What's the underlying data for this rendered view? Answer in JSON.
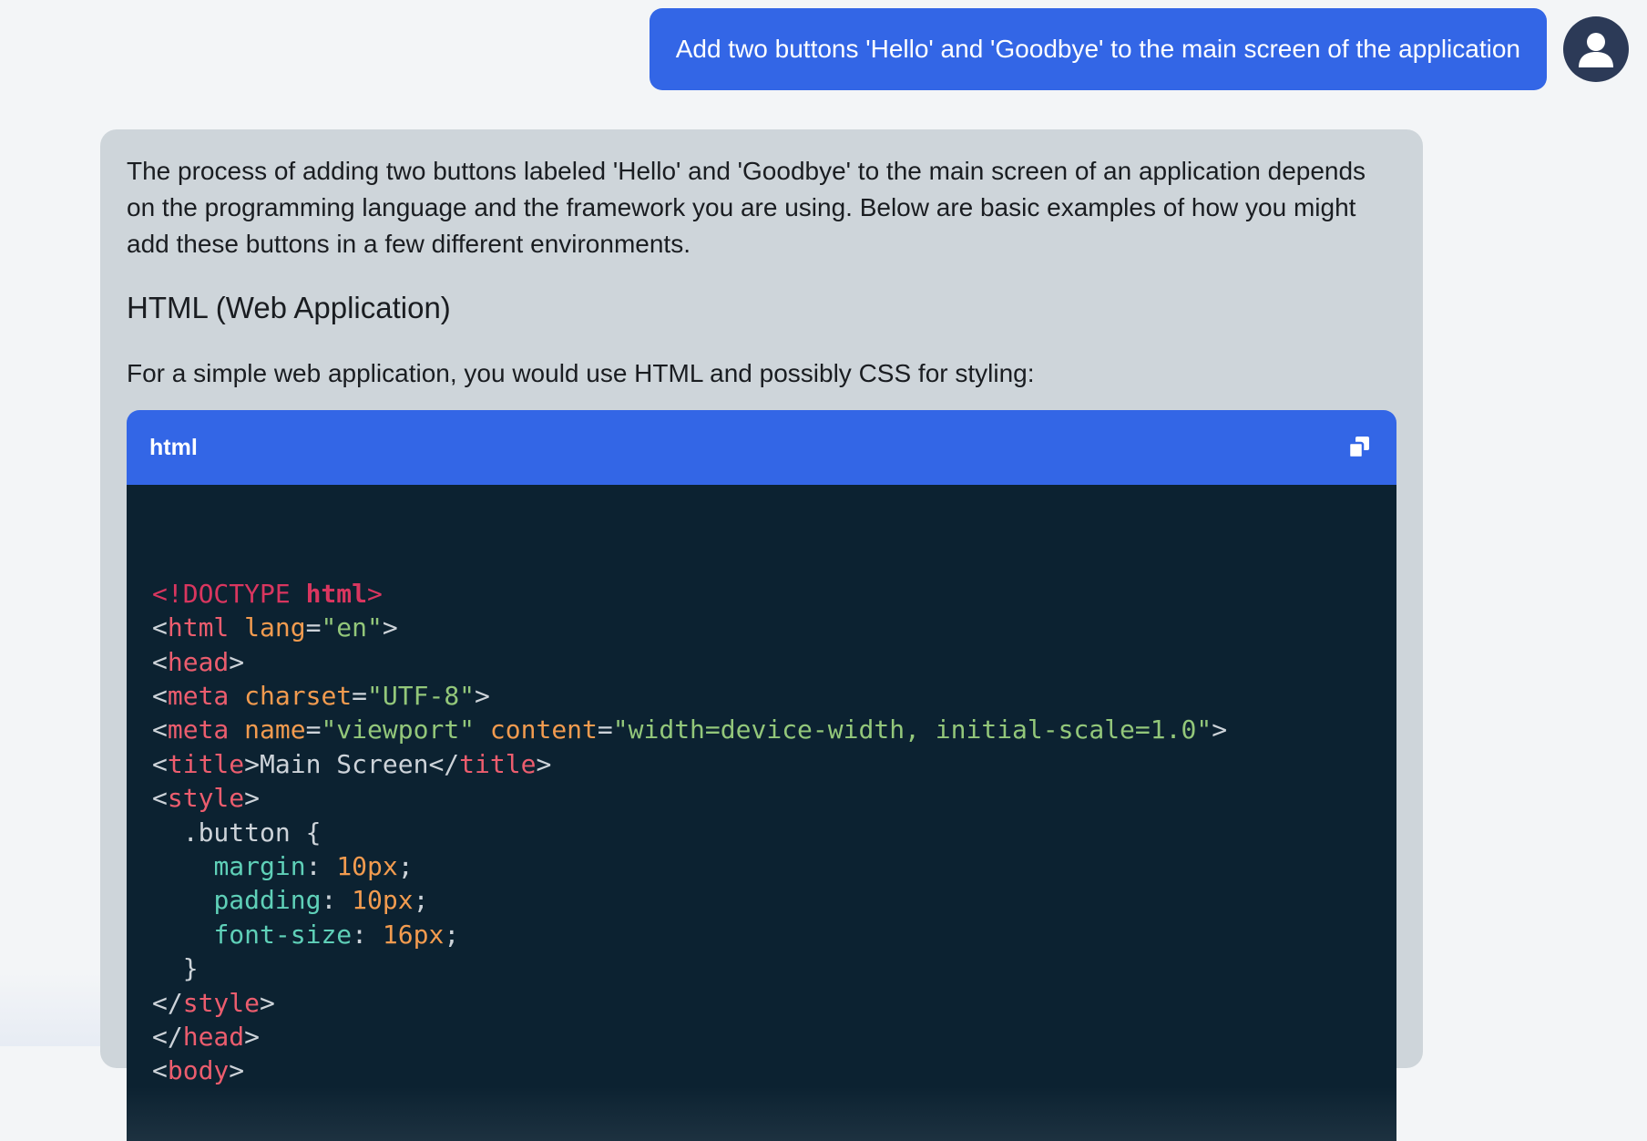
{
  "user_message": {
    "text": "Add two buttons 'Hello' and 'Goodbye' to the main screen of the application"
  },
  "assistant_message": {
    "intro": "The process of adding two buttons labeled 'Hello' and 'Goodbye' to the main screen of an application depends on the programming language and the framework you are using. Below are basic examples of how you might add these buttons in a few different environments.",
    "section_heading": "HTML (Web Application)",
    "subintro": "For a simple web application, you would use HTML and possibly CSS for styling:",
    "code_block": {
      "language": "html",
      "copy_icon": "copy-icon",
      "lines": [
        [
          [
            "<!DOCTYPE ",
            "#d9365f"
          ],
          [
            "html",
            "#d9365f",
            "bold"
          ],
          [
            ">",
            "#d9365f"
          ]
        ],
        [
          [
            "<",
            "#cdd3d9"
          ],
          [
            "html",
            "#ec5d6e"
          ],
          [
            " ",
            "#cdd3d9"
          ],
          [
            "lang",
            "#f29b4f"
          ],
          [
            "=",
            "#cdd3d9"
          ],
          [
            "\"en\"",
            "#93c77a"
          ],
          [
            ">",
            "#cdd3d9"
          ]
        ],
        [
          [
            "<",
            "#cdd3d9"
          ],
          [
            "head",
            "#ec5d6e"
          ],
          [
            ">",
            "#cdd3d9"
          ]
        ],
        [
          [
            "<",
            "#cdd3d9"
          ],
          [
            "meta",
            "#ec5d6e"
          ],
          [
            " ",
            "#cdd3d9"
          ],
          [
            "charset",
            "#f29b4f"
          ],
          [
            "=",
            "#cdd3d9"
          ],
          [
            "\"UTF-8\"",
            "#93c77a"
          ],
          [
            ">",
            "#cdd3d9"
          ]
        ],
        [
          [
            "<",
            "#cdd3d9"
          ],
          [
            "meta",
            "#ec5d6e"
          ],
          [
            " ",
            "#cdd3d9"
          ],
          [
            "name",
            "#f29b4f"
          ],
          [
            "=",
            "#cdd3d9"
          ],
          [
            "\"viewport\"",
            "#93c77a"
          ],
          [
            " ",
            "#cdd3d9"
          ],
          [
            "content",
            "#f29b4f"
          ],
          [
            "=",
            "#cdd3d9"
          ],
          [
            "\"width=device-width, initial-scale=1.0\"",
            "#93c77a"
          ],
          [
            ">",
            "#cdd3d9"
          ]
        ],
        [
          [
            "<",
            "#cdd3d9"
          ],
          [
            "title",
            "#ec5d6e"
          ],
          [
            ">Main Screen</",
            "#cdd3d9"
          ],
          [
            "title",
            "#ec5d6e"
          ],
          [
            ">",
            "#cdd3d9"
          ]
        ],
        [
          [
            "<",
            "#cdd3d9"
          ],
          [
            "style",
            "#ec5d6e"
          ],
          [
            ">",
            "#cdd3d9"
          ]
        ],
        [
          [
            "  .button {",
            "#cdd3d9"
          ]
        ],
        [
          [
            "    ",
            "#cdd3d9"
          ],
          [
            "margin",
            "#5fd0b8"
          ],
          [
            ": ",
            "#cdd3d9"
          ],
          [
            "10px",
            "#f29b4f"
          ],
          [
            ";",
            "#cdd3d9"
          ]
        ],
        [
          [
            "    ",
            "#cdd3d9"
          ],
          [
            "padding",
            "#5fd0b8"
          ],
          [
            ": ",
            "#cdd3d9"
          ],
          [
            "10px",
            "#f29b4f"
          ],
          [
            ";",
            "#cdd3d9"
          ]
        ],
        [
          [
            "    ",
            "#cdd3d9"
          ],
          [
            "font-size",
            "#5fd0b8"
          ],
          [
            ": ",
            "#cdd3d9"
          ],
          [
            "16px",
            "#f29b4f"
          ],
          [
            ";",
            "#cdd3d9"
          ]
        ],
        [
          [
            "  }",
            "#cdd3d9"
          ]
        ],
        [
          [
            "</",
            "#cdd3d9"
          ],
          [
            "style",
            "#ec5d6e"
          ],
          [
            ">",
            "#cdd3d9"
          ]
        ],
        [
          [
            "</",
            "#cdd3d9"
          ],
          [
            "head",
            "#ec5d6e"
          ],
          [
            ">",
            "#cdd3d9"
          ]
        ],
        [
          [
            "<",
            "#cdd3d9"
          ],
          [
            "body",
            "#ec5d6e"
          ],
          [
            ">",
            "#cdd3d9"
          ]
        ]
      ]
    }
  },
  "colors": {
    "accent": "#3366e6",
    "page_bg": "#f3f5f7",
    "card_bg": "#ced5da",
    "code_bg": "#0c2231",
    "avatar_bg": "#2c3a57"
  }
}
